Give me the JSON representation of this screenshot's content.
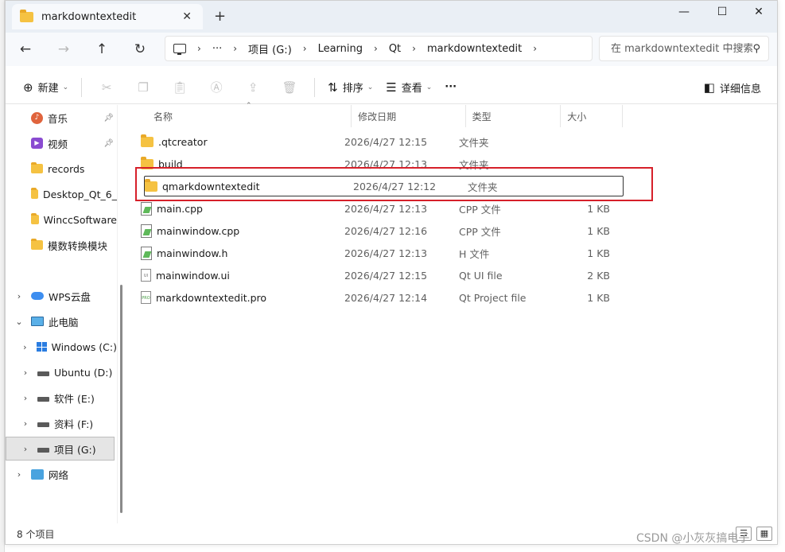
{
  "tab": {
    "title": "markdowntextedit",
    "close_glyph": "✕",
    "new_tab_glyph": "+"
  },
  "window_controls": {
    "minimize": "—",
    "maximize": "☐",
    "close": "✕"
  },
  "nav": {
    "back": "←",
    "forward": "→",
    "up": "↑",
    "refresh": "↻"
  },
  "address": {
    "more": "···",
    "crumbs": [
      "项目 (G:)",
      "Learning",
      "Qt",
      "markdowntextedit"
    ]
  },
  "search": {
    "placeholder": "在 markdowntextedit 中搜索"
  },
  "toolbar": {
    "new_label": "新建",
    "sort_label": "排序",
    "view_label": "查看",
    "more_label": "···",
    "details_label": "详细信息"
  },
  "sidebar": {
    "items": [
      {
        "label": "音乐",
        "icon": "music-icon",
        "pinned": true
      },
      {
        "label": "视频",
        "icon": "video-icon",
        "pinned": true
      },
      {
        "label": "records",
        "icon": "folder-icon"
      },
      {
        "label": "Desktop_Qt_6_",
        "icon": "folder-icon"
      },
      {
        "label": "WinccSoftware",
        "icon": "folder-icon"
      },
      {
        "label": "模数转换模块",
        "icon": "folder-icon"
      },
      {
        "label": "WPS云盘",
        "icon": "cloud-icon",
        "expander": "›"
      },
      {
        "label": "此电脑",
        "icon": "pc-icon",
        "expander": "⌄"
      },
      {
        "label": "Windows (C:)",
        "icon": "windows-drive-icon",
        "expander": "›"
      },
      {
        "label": "Ubuntu (D:)",
        "icon": "drive-icon",
        "expander": "›"
      },
      {
        "label": "软件 (E:)",
        "icon": "drive-icon",
        "expander": "›"
      },
      {
        "label": "资料 (F:)",
        "icon": "drive-icon",
        "expander": "›"
      },
      {
        "label": "项目 (G:)",
        "icon": "drive-icon",
        "expander": "›",
        "selected": true
      },
      {
        "label": "网络",
        "icon": "network-icon",
        "expander": "›"
      }
    ]
  },
  "columns": {
    "name": "名称",
    "modified": "修改日期",
    "type": "类型",
    "size": "大小"
  },
  "files": [
    {
      "name": ".qtcreator",
      "modified": "2026/4/27 12:15",
      "type": "文件夹",
      "size": "",
      "icon": "folder-icon"
    },
    {
      "name": "build",
      "modified": "2026/4/27 12:13",
      "type": "文件夹",
      "size": "",
      "icon": "folder-icon"
    },
    {
      "name": "qmarkdowntextedit",
      "modified": "2026/4/27 12:12",
      "type": "文件夹",
      "size": "",
      "icon": "folder-icon",
      "highlighted": true
    },
    {
      "name": "main.cpp",
      "modified": "2026/4/27 12:13",
      "type": "CPP 文件",
      "size": "1 KB",
      "icon": "cpp-file-icon"
    },
    {
      "name": "mainwindow.cpp",
      "modified": "2026/4/27 12:16",
      "type": "CPP 文件",
      "size": "1 KB",
      "icon": "cpp-file-icon"
    },
    {
      "name": "mainwindow.h",
      "modified": "2026/4/27 12:13",
      "type": "H 文件",
      "size": "1 KB",
      "icon": "h-file-icon"
    },
    {
      "name": "mainwindow.ui",
      "modified": "2026/4/27 12:15",
      "type": "Qt UI file",
      "size": "2 KB",
      "icon": "ui-file-icon"
    },
    {
      "name": "markdowntextedit.pro",
      "modified": "2026/4/27 12:14",
      "type": "Qt Project file",
      "size": "1 KB",
      "icon": "pro-file-icon"
    }
  ],
  "status": {
    "count": "8 个项目"
  },
  "watermark": "CSDN @小灰灰搞电子",
  "colors": {
    "annotation_red": "#d6202a",
    "folder_yellow": "#f5c242",
    "titlebar_bg": "#eaeff5"
  }
}
